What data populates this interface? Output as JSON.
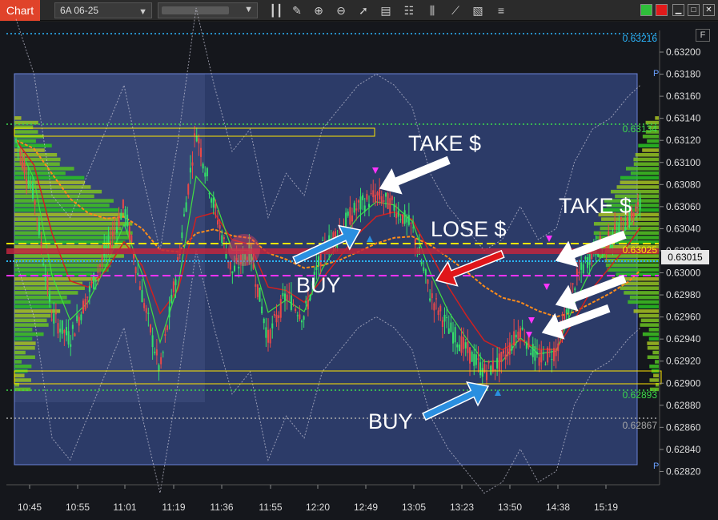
{
  "toolbar": {
    "chart_tab": "Chart",
    "symbol": "6A 06-25",
    "account": "",
    "icons": [
      "bar-style-icon",
      "pencil-icon",
      "zoom-in-icon",
      "zoom-out-icon",
      "cursor-icon",
      "data-box-icon",
      "properties-icon",
      "indicators-icon",
      "strategies-icon",
      "templates-icon",
      "menu-icon"
    ]
  },
  "window_buttons": [
    "link-green",
    "link-red",
    "minimize",
    "maximize",
    "close"
  ],
  "current_price": "0.63015",
  "f_button": "F",
  "colors": {
    "background": "#15171c",
    "range_box": "#3f5aa8",
    "buy_arrow": "#2a8fe0",
    "lose_arrow": "#e0161a",
    "take_arrow": "#ffffff",
    "up_candle": "#34e06a",
    "down_candle": "#e84848",
    "vwap_orange": "#ff8c1a",
    "level_yellow": "#ffe600",
    "level_magenta": "#ff33ff",
    "level_green": "#3ddc4a",
    "level_cyan": "#2bb7ff"
  },
  "annotations": {
    "take1": "TAKE $",
    "take2": "TAKE $",
    "lose": "LOSE $",
    "buy1": "BUY",
    "buy2": "BUY"
  },
  "chart_data": {
    "type": "candlestick",
    "title": "",
    "xlabel": "",
    "ylabel": "",
    "ylim": [
      0.6281,
      0.6322
    ],
    "x_ticks": [
      "10:45",
      "10:55",
      "11:01",
      "11:19",
      "11:36",
      "11:55",
      "12:20",
      "12:49",
      "13:05",
      "13:23",
      "13:50",
      "14:38",
      "15:19"
    ],
    "y_ticks": [
      "0.63200",
      "0.63180",
      "0.63160",
      "0.63140",
      "0.63120",
      "0.63100",
      "0.63080",
      "0.63060",
      "0.63040",
      "0.63020",
      "0.63000",
      "0.62980",
      "0.62960",
      "0.62940",
      "0.62920",
      "0.62900",
      "0.62880",
      "0.62860",
      "0.62840",
      "0.62820"
    ],
    "level_labels": [
      {
        "text": "0.63216",
        "value": 0.63216,
        "color": "#2bb7ff"
      },
      {
        "text": "0.63134",
        "value": 0.63134,
        "color": "#3ddc4a"
      },
      {
        "text": "0.63025",
        "value": 0.63025,
        "color": "#ffe600"
      },
      {
        "text": "0.62893",
        "value": 0.62893,
        "color": "#3ddc4a"
      },
      {
        "text": "0.62867",
        "value": 0.62867,
        "color": "#aaaaaa"
      }
    ],
    "price_path": [
      [
        0,
        0.6312
      ],
      [
        3,
        0.6307
      ],
      [
        6,
        0.6296
      ],
      [
        9,
        0.6294
      ],
      [
        12,
        0.6298
      ],
      [
        15,
        0.6302
      ],
      [
        18,
        0.6306
      ],
      [
        21,
        0.6298
      ],
      [
        24,
        0.6291
      ],
      [
        27,
        0.6301
      ],
      [
        30,
        0.6313
      ],
      [
        33,
        0.6306
      ],
      [
        36,
        0.63
      ],
      [
        39,
        0.6302
      ],
      [
        42,
        0.6294
      ],
      [
        45,
        0.6298
      ],
      [
        48,
        0.6296
      ],
      [
        51,
        0.6302
      ],
      [
        54,
        0.6304
      ],
      [
        57,
        0.6306
      ],
      [
        60,
        0.6307
      ],
      [
        63,
        0.6306
      ],
      [
        66,
        0.6304
      ],
      [
        69,
        0.6298
      ],
      [
        72,
        0.6295
      ],
      [
        75,
        0.6293
      ],
      [
        78,
        0.6291
      ],
      [
        81,
        0.6292
      ],
      [
        84,
        0.6295
      ],
      [
        87,
        0.6292
      ],
      [
        90,
        0.6293
      ],
      [
        93,
        0.6299
      ],
      [
        96,
        0.6302
      ],
      [
        99,
        0.6303
      ],
      [
        102,
        0.6305
      ],
      [
        104,
        0.6306
      ]
    ],
    "x_range": [
      0,
      104
    ]
  }
}
